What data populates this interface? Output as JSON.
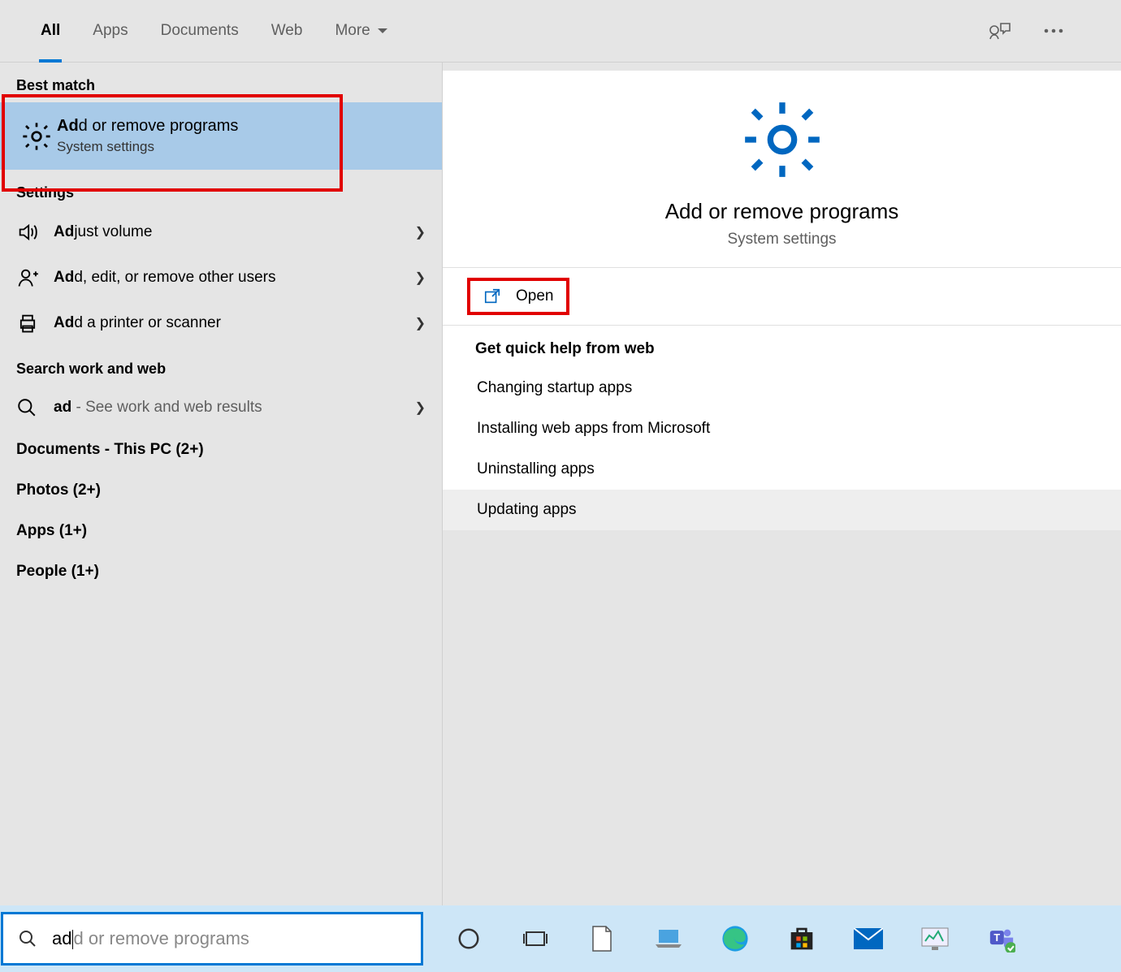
{
  "tabs": {
    "all": "All",
    "apps": "Apps",
    "documents": "Documents",
    "web": "Web",
    "more": "More"
  },
  "sections": {
    "best_match": "Best match",
    "settings": "Settings",
    "search_web": "Search work and web"
  },
  "best_match": {
    "title_bold": "Ad",
    "title_rest": "d or remove programs",
    "subtitle": "System settings"
  },
  "settings_rows": [
    {
      "bold": "Ad",
      "rest": "just volume"
    },
    {
      "bold": "Ad",
      "rest": "d, edit, or remove other users"
    },
    {
      "bold": "Ad",
      "rest": "d a printer or scanner"
    }
  ],
  "web_row": {
    "bold": "ad",
    "grey": " - See work and web results"
  },
  "categories": [
    "Documents - This PC (2+)",
    "Photos (2+)",
    "Apps (1+)",
    "People (1+)"
  ],
  "preview": {
    "title": "Add or remove programs",
    "subtitle": "System settings",
    "open": "Open",
    "help_title": "Get quick help from web",
    "help_items": [
      "Changing startup apps",
      "Installing web apps from Microsoft",
      "Uninstalling apps",
      "Updating apps"
    ]
  },
  "searchbox": {
    "typed": "ad",
    "ghost": "d or remove programs"
  }
}
